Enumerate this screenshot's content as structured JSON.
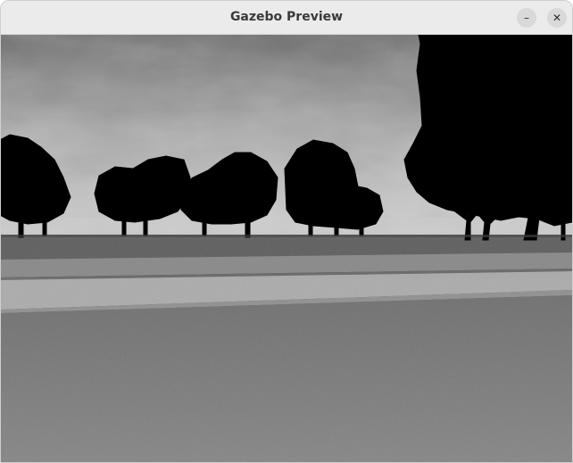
{
  "window": {
    "title": "Gazebo Preview",
    "minimize_glyph": "–",
    "close_glyph": "✕"
  },
  "viewport": {
    "scene": "outdoor-road-with-trees",
    "colors": {
      "sky_top": "#6f6f6f",
      "sky_mid": "#b8b8b8",
      "horizon": "#cfcfcf",
      "grass": "#5a5a5a",
      "curb": "#8a8a8a",
      "sidewalk": "#aeaeae",
      "road": "#7a7a7a",
      "trees": "#000000"
    }
  }
}
